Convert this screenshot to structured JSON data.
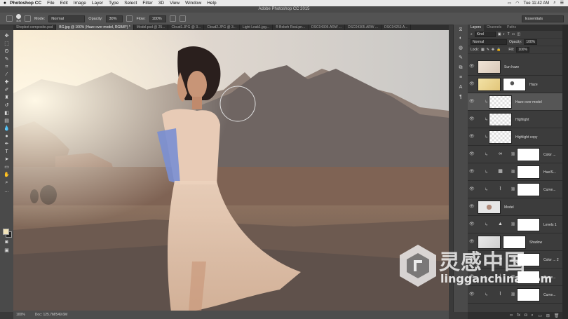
{
  "menubar": {
    "apple": "",
    "app_name": "Photoshop CC",
    "items": [
      "File",
      "Edit",
      "Image",
      "Layer",
      "Type",
      "Select",
      "Filter",
      "3D",
      "View",
      "Window",
      "Help"
    ],
    "clock": "Tue 11:42 AM"
  },
  "window": {
    "title": "Adobe Photoshop CC 2015"
  },
  "options": {
    "mode_label": "Mode:",
    "mode_value": "Normal",
    "opacity_label": "Opacity:",
    "opacity_value": "30%",
    "flow_label": "Flow:",
    "flow_value": "100%",
    "brush_size": "400",
    "workspace": "Essentials"
  },
  "doc_tabs": [
    {
      "label": "Shepbot composite.psd",
      "active": false
    },
    {
      "label": "BG.jpg @ 100% (Haze over model, RGB/8*) *",
      "active": true
    },
    {
      "label": "Model.psd @ 25...",
      "active": false
    },
    {
      "label": "Cloud1.JPG @ 3...",
      "active": false
    },
    {
      "label": "Cloud2.JPG @ 3...",
      "active": false
    },
    {
      "label": "Light Leak1.jpg...",
      "active": false
    },
    {
      "label": "® Bokeh Real.pn...",
      "active": false
    },
    {
      "label": "DSC04306.ARW ...",
      "active": false
    },
    {
      "label": "DSC04305.ARW ...",
      "active": false
    },
    {
      "label": "DSC04253.A...",
      "active": false
    }
  ],
  "status": {
    "zoom": "100%",
    "doc": "Doc: 125.7M/549.6M"
  },
  "panel": {
    "tabs": [
      "Layers",
      "Channels",
      "Paths"
    ],
    "filter_label": "Kind",
    "blend_mode": "Normal",
    "opacity_label": "Opacity:",
    "opacity_value": "100%",
    "lock_label": "Lock:",
    "fill_label": "Fill:",
    "fill_value": "100%",
    "layers": [
      {
        "name": "Sun haze",
        "thumb": "warm",
        "mask": false,
        "adj": "",
        "clip": false,
        "selected": false
      },
      {
        "name": "Haze",
        "thumb": "gold",
        "mask": "spots",
        "adj": "",
        "clip": false,
        "selected": false
      },
      {
        "name": "Haze over model",
        "thumb": "checker",
        "mask": false,
        "adj": "",
        "clip": true,
        "selected": true
      },
      {
        "name": "Highlight",
        "thumb": "checker",
        "mask": false,
        "adj": "",
        "clip": true,
        "selected": false
      },
      {
        "name": "Highlight copy",
        "thumb": "checker",
        "mask": false,
        "adj": "",
        "clip": true,
        "selected": false
      },
      {
        "name": "Color ...",
        "thumb": "",
        "mask": "white",
        "adj": "∞",
        "clip": true,
        "selected": false
      },
      {
        "name": "Hue/S...",
        "thumb": "",
        "mask": "white",
        "adj": "▦",
        "clip": true,
        "selected": false
      },
      {
        "name": "Curve...",
        "thumb": "",
        "mask": "white",
        "adj": "⌇",
        "clip": true,
        "selected": false
      },
      {
        "name": "Model",
        "thumb": "model",
        "mask": false,
        "adj": "",
        "clip": false,
        "selected": false
      },
      {
        "name": "Levels 1",
        "thumb": "",
        "mask": "white",
        "adj": "▲",
        "clip": true,
        "selected": false
      },
      {
        "name": "Shadow",
        "thumb": "grey",
        "mask": "white",
        "adj": "",
        "clip": false,
        "selected": false
      },
      {
        "name": "Color ... 2",
        "thumb": "",
        "mask": "white",
        "adj": "∞",
        "clip": true,
        "selected": false
      },
      {
        "name": "Curve...",
        "thumb": "",
        "mask": "white",
        "adj": "⌇",
        "clip": true,
        "selected": false
      },
      {
        "name": "Curve...",
        "thumb": "",
        "mask": "white",
        "adj": "⌇",
        "clip": true,
        "selected": false
      }
    ]
  },
  "watermark": {
    "cn": "灵感中国",
    "en": "lingganchina.com"
  },
  "colors": {
    "fg": "#f1e2b8",
    "bg": "#222222",
    "accent": "#3d6bd8"
  }
}
